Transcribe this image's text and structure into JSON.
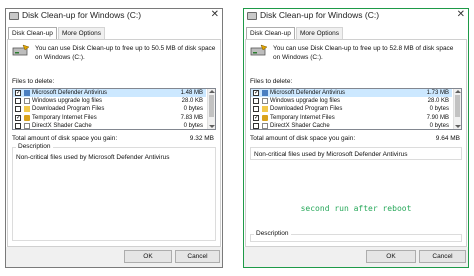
{
  "window1": {
    "title": "Disk Clean-up for Windows (C:)",
    "close_glyph": "✕",
    "tabs": [
      "Disk Clean-up",
      "More Options"
    ],
    "info_text": "You can use Disk Clean-up to free up to 50.5 MB of disk space on Windows (C:).",
    "files_label": "Files to delete:",
    "files": [
      {
        "name": "Microsoft Defender Antivirus",
        "size": "1.48 MB",
        "checked": true,
        "selected": true
      },
      {
        "name": "Windows upgrade log files",
        "size": "28.0 KB",
        "checked": false,
        "selected": false
      },
      {
        "name": "Downloaded Program Files",
        "size": "0 bytes",
        "checked": false,
        "selected": false
      },
      {
        "name": "Temporary Internet Files",
        "size": "7.83 MB",
        "checked": true,
        "selected": false
      },
      {
        "name": "DirectX Shader Cache",
        "size": "0 bytes",
        "checked": false,
        "selected": false
      }
    ],
    "total_label": "Total amount of disk space you gain:",
    "total_value": "9.32 MB",
    "description_legend": "Description",
    "description_text": "Non-critical files used by Microsoft Defender Antivirus",
    "ok_label": "OK",
    "cancel_label": "Cancel"
  },
  "window2": {
    "title": "Disk Clean-up for Windows (C:)",
    "close_glyph": "✕",
    "tabs": [
      "Disk Clean-up",
      "More Options"
    ],
    "info_text": "You can use Disk Clean-up to free up to 52.8 MB of disk space on Windows (C:).",
    "files_label": "Files to delete:",
    "files": [
      {
        "name": "Microsoft Defender Antivirus",
        "size": "1.73 MB",
        "checked": true,
        "selected": true
      },
      {
        "name": "Windows upgrade log files",
        "size": "28.0 KB",
        "checked": false,
        "selected": false
      },
      {
        "name": "Downloaded Program Files",
        "size": "0 bytes",
        "checked": false,
        "selected": false
      },
      {
        "name": "Temporary Internet Files",
        "size": "7.90 MB",
        "checked": true,
        "selected": false
      },
      {
        "name": "DirectX Shader Cache",
        "size": "0 bytes",
        "checked": false,
        "selected": false
      }
    ],
    "total_label": "Total amount of disk space you gain:",
    "total_value": "9.64 MB",
    "description_legend": "Description",
    "description_text": "Non-critical files used by Microsoft Defender Antivirus",
    "annotation": "second run after reboot",
    "ok_label": "OK",
    "cancel_label": "Cancel"
  },
  "check_glyph": "✓",
  "colors": {
    "selection": "#cce8ff",
    "annotation_green": "#27a85a",
    "window2_border": "#1e9a48"
  },
  "icons": {
    "app": "disk-cleanup-app-icon",
    "drive": "drive-cleanup-icon",
    "file_types": [
      "shield-icon",
      "document-icon",
      "folder-icon",
      "lock-icon",
      "document-icon"
    ]
  }
}
